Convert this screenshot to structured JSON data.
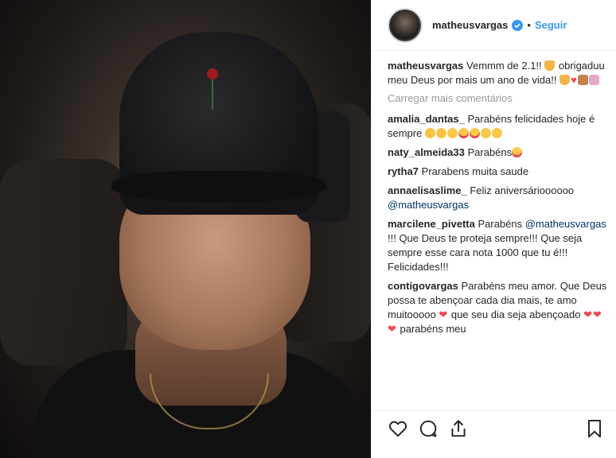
{
  "post": {
    "author": {
      "username": "matheusvargas",
      "verified": true,
      "follow_label": "Seguir",
      "separator": "•"
    },
    "caption": {
      "user": "matheusvargas",
      "text": "Vemmm de 2.1!! ",
      "text2": " obrigaduu meu Deus por mais um ano de vida!! "
    },
    "load_more_label": "Carregar mais comentários",
    "comments": [
      {
        "user": "amalia_dantas_",
        "text": "Parabéns felicidades hoje é sempre "
      },
      {
        "user": "naty_almeida33",
        "text": "Parabéns"
      },
      {
        "user": "rytha7",
        "text": "Prarabens muita saude"
      },
      {
        "user": "annaelisaslime_",
        "text": "Feliz aniversárioooooo ",
        "mention": "@matheusvargas"
      },
      {
        "user": "marcilene_pivetta",
        "text_before": "Parabéns ",
        "mention": "@matheusvargas",
        "text_after": " !!! Que Deus te proteja sempre!!! Que seja sempre esse cara nota 1000 que tu é!!! Felicidades!!!"
      },
      {
        "user": "contigovargas",
        "text": "Parabéns meu amor. Que Deus possa te abençoar cada dia mais, te amo muitooooo ",
        "text2": " que seu dia seja abençoado ",
        "text3": " parabéns meu"
      }
    ],
    "icons": {
      "like": "heart-outline-icon",
      "comment": "comment-bubble-icon",
      "share": "share-upload-icon",
      "save": "bookmark-icon"
    },
    "colors": {
      "link_blue": "#3897f0",
      "muted": "#999999",
      "heart_red": "#ed4956"
    }
  }
}
